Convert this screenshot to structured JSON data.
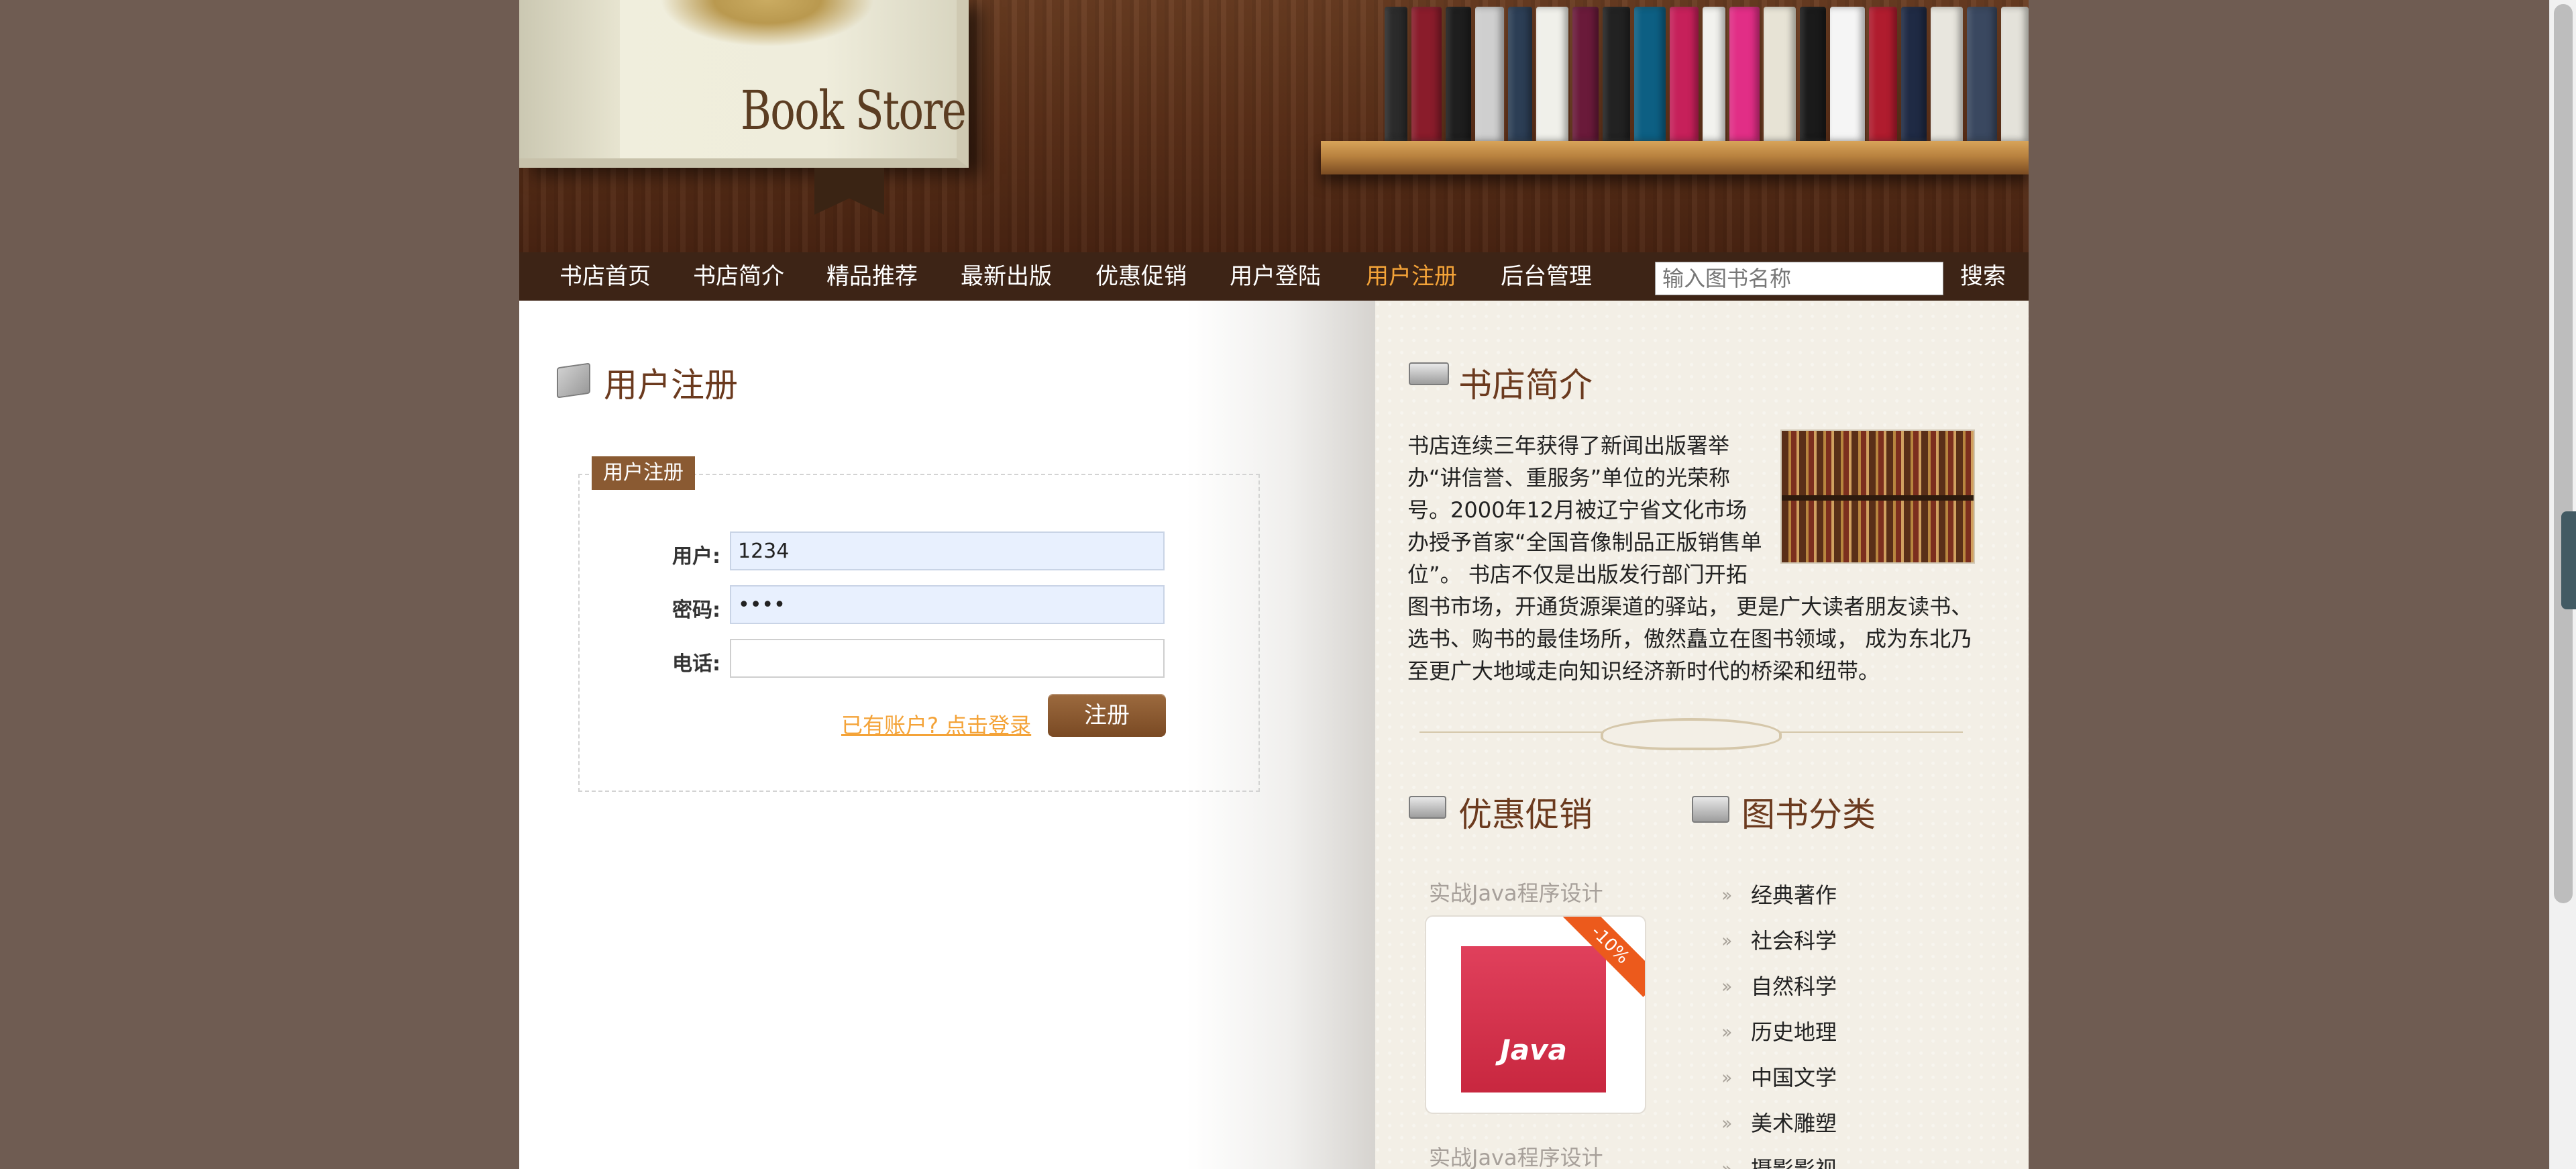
{
  "header": {
    "logo_text": "Book Store",
    "shelf_colors": [
      "#2b2b2b",
      "#8a1c2b",
      "#1e1e1e",
      "#cfcfcf",
      "#2c3e55",
      "#f0f0ea",
      "#6a1a3a",
      "#222222",
      "#0d5f83",
      "#c6205a",
      "#f2f2ee",
      "#e12e86",
      "#e7e3d5",
      "#1a1a1a",
      "#f5f5f5",
      "#b01c2e",
      "#1f2a44",
      "#e8e6de",
      "#3a4860",
      "#e4e2da"
    ],
    "shelf_widths": [
      40,
      52,
      44,
      50,
      42,
      56,
      46,
      48,
      54,
      50,
      40,
      52,
      56,
      46,
      60,
      50,
      44,
      56,
      52,
      48
    ]
  },
  "nav": {
    "items": [
      {
        "label": "书店首页"
      },
      {
        "label": "书店简介"
      },
      {
        "label": "精品推荐"
      },
      {
        "label": "最新出版"
      },
      {
        "label": "优惠促销"
      },
      {
        "label": "用户登陆"
      },
      {
        "label": "用户注册",
        "active": true
      },
      {
        "label": "后台管理"
      }
    ],
    "search_placeholder": "输入图书名称",
    "search_button": "搜索",
    "active_color": "#f4a338"
  },
  "main": {
    "title": "用户注册",
    "form": {
      "legend": "用户注册",
      "username_label": "用户:",
      "username_value": "1234",
      "password_label": "密码:",
      "password_value": "1234",
      "phone_label": "电话:",
      "phone_value": "",
      "login_link": "已有账户? 点击登录",
      "submit_label": "注册"
    }
  },
  "sidebar": {
    "about_title": "书店简介",
    "about_text": "书店连续三年获得了新闻出版署举办“讲信誉、重服务”单位的光荣称号。2000年12月被辽宁省文化市场办授予首家“全国音像制品正版销售单位”。 书店不仅是出版发行部门开拓图书市场，开通货源渠道的驿站， 更是广大读者朋友读书、选书、购书的最佳场所，傲然矗立在图书领域， 成为东北乃至更广大地域走向知识经济新时代的桥梁和纽带。",
    "promo_title": "优惠促销",
    "promo_book_title": "实战Java程序设计",
    "promo_book_title_2": "实战Java程序设计",
    "promo_badge": "-10%",
    "promo_cover_text": "Java",
    "category_title": "图书分类",
    "categories": [
      "经典著作",
      "社会科学",
      "自然科学",
      "历史地理",
      "中国文学",
      "美术雕塑",
      "摄影影视"
    ]
  }
}
